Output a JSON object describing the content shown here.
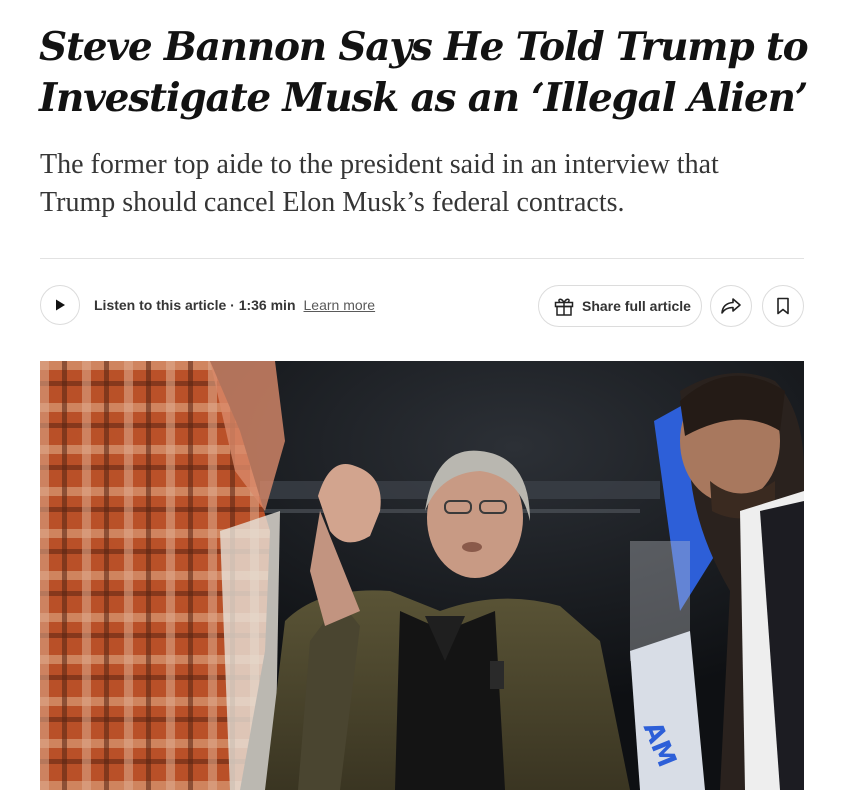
{
  "article": {
    "headline_line1": "Steve Bannon Says He Told Trump to",
    "headline_line2": "Investigate Musk as an ‘Illegal Alien’",
    "summary_line1": "The former top aide to the president said in an interview that",
    "summary_line2": "Trump should cancel Elon Musk’s federal contracts."
  },
  "toolbar": {
    "listen_label": "Listen to this article · 1:36 min",
    "learn_more_label": "Learn more",
    "share_full_label": "Share full article",
    "icons": {
      "play": "play-icon",
      "gift": "gift-icon",
      "share": "share-arrow-icon",
      "bookmark": "bookmark-icon"
    }
  },
  "photo": {
    "sign_text": "AM"
  },
  "colors": {
    "headline": "#121212",
    "summary": "#363636",
    "divider": "#e2e2e2"
  }
}
